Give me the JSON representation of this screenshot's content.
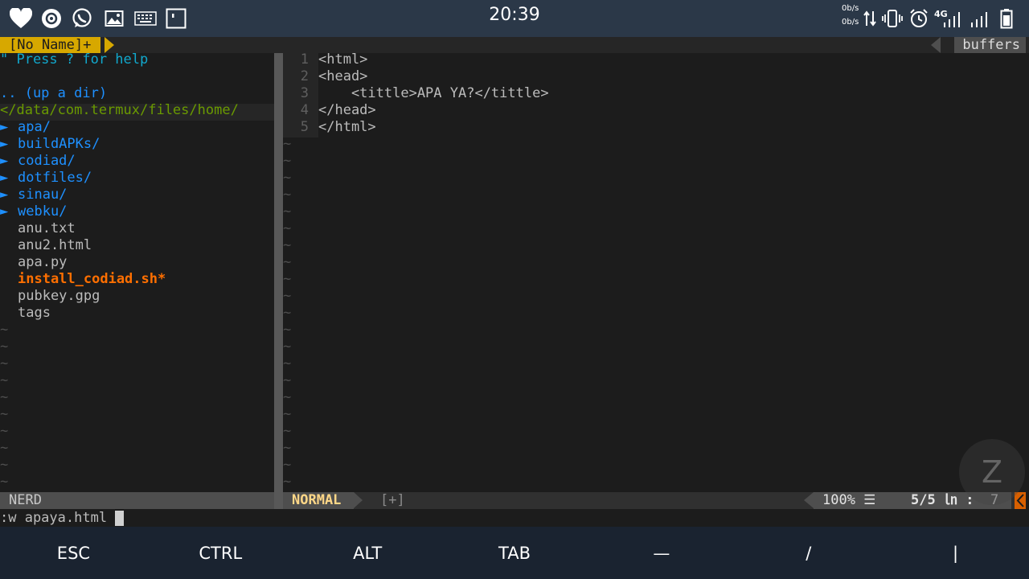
{
  "status_bar": {
    "time": "20:39",
    "net_up": "0b/s",
    "net_down": "0b/s",
    "network_type": "4G"
  },
  "tabline": {
    "left_tab": "[No Name]+",
    "right_label": "buffers"
  },
  "nerdtree": {
    "help_line": "\" Press ? for help",
    "up_dir": ".. (up a dir)",
    "cwd": "</data/com.termux/files/home/",
    "dir_arrow": "►",
    "dirs": [
      "apa/",
      "buildAPKs/",
      "codiad/",
      "dotfiles/",
      "sinau/",
      "webku/"
    ],
    "files": [
      {
        "name": "anu.txt"
      },
      {
        "name": "anu2.html"
      },
      {
        "name": "apa.py"
      },
      {
        "name": "install_codiad.sh*"
      },
      {
        "name": "pubkey.gpg"
      },
      {
        "name": "tags"
      }
    ],
    "status_label": "NERD"
  },
  "editor": {
    "lines": [
      {
        "num": "1",
        "text": "<html>"
      },
      {
        "num": "2",
        "text": "<head>"
      },
      {
        "num": "3",
        "text": "    <tittle>APA YA?</tittle>"
      },
      {
        "num": "4",
        "text": "</head>"
      },
      {
        "num": "5",
        "text": "</html>"
      }
    ],
    "tilde": "~"
  },
  "statusline": {
    "mode": "NORMAL",
    "modified": "[+]",
    "percent": "100% ☰",
    "lines": "5/5",
    "line_symbol": "㏑",
    "col_sep": ":",
    "col": "7"
  },
  "cmdline": {
    "text": ":w apaya.html"
  },
  "extra_keys": [
    "ESC",
    "CTRL",
    "ALT",
    "TAB",
    "—",
    "/",
    "|"
  ],
  "floating_bubble": "Z",
  "colors": {
    "statusbar_bg": "#2b3848",
    "tab_accent": "#d7a800",
    "dir_blue": "#1e90ff",
    "help_cyan": "#11a8cd",
    "cwd_green": "#6a9a00",
    "exec_orange": "#ff6f00",
    "mode_yellow": "#ffd787",
    "warning_orange": "#d75f00"
  }
}
